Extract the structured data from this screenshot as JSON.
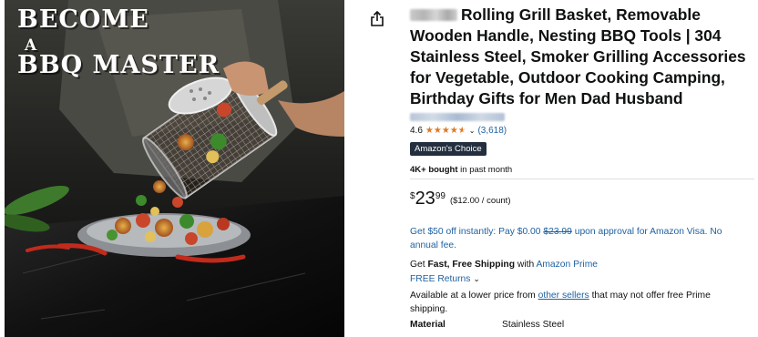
{
  "hero": {
    "line1": "BECOME",
    "line2": "A",
    "line3": "BBQ MASTER"
  },
  "share": {
    "icon": "share-icon"
  },
  "product": {
    "title": "Rolling Grill Basket, Removable Wooden Handle, Nesting BBQ Tools | 304 Stainless Steel, Smoker Grilling Accessories for Vegetable, Outdoor Cooking Camping, Birthday Gifts for Men Dad Husband",
    "rating_value": "4.6",
    "stars": 4.6,
    "rating_count": "(3,618)",
    "badge": "Amazon's Choice",
    "bought_bold": "4K+ bought",
    "bought_rest": " in past month",
    "price_symbol": "$",
    "price_whole": "23",
    "price_fraction": "99",
    "price_unit": "($12.00 / count)"
  },
  "promo": {
    "text_before": "Get $50 off instantly: Pay $0.00 ",
    "strike": "$23.99",
    "text_after": " upon approval for Amazon Visa. No annual fee."
  },
  "shipping": {
    "get": "Get ",
    "fast": "Fast, Free Shipping",
    "with": " with ",
    "prime": "Amazon Prime",
    "returns": "FREE Returns",
    "lower_before": "Available at a lower price from ",
    "lower_link": "other sellers",
    "lower_after": " that may not offer free Prime shipping."
  },
  "spec": {
    "key": "Material",
    "value": "Stainless Steel"
  },
  "colors": {
    "link": "#2162a1",
    "star": "#de7921",
    "badge_bg": "#232f3e"
  }
}
